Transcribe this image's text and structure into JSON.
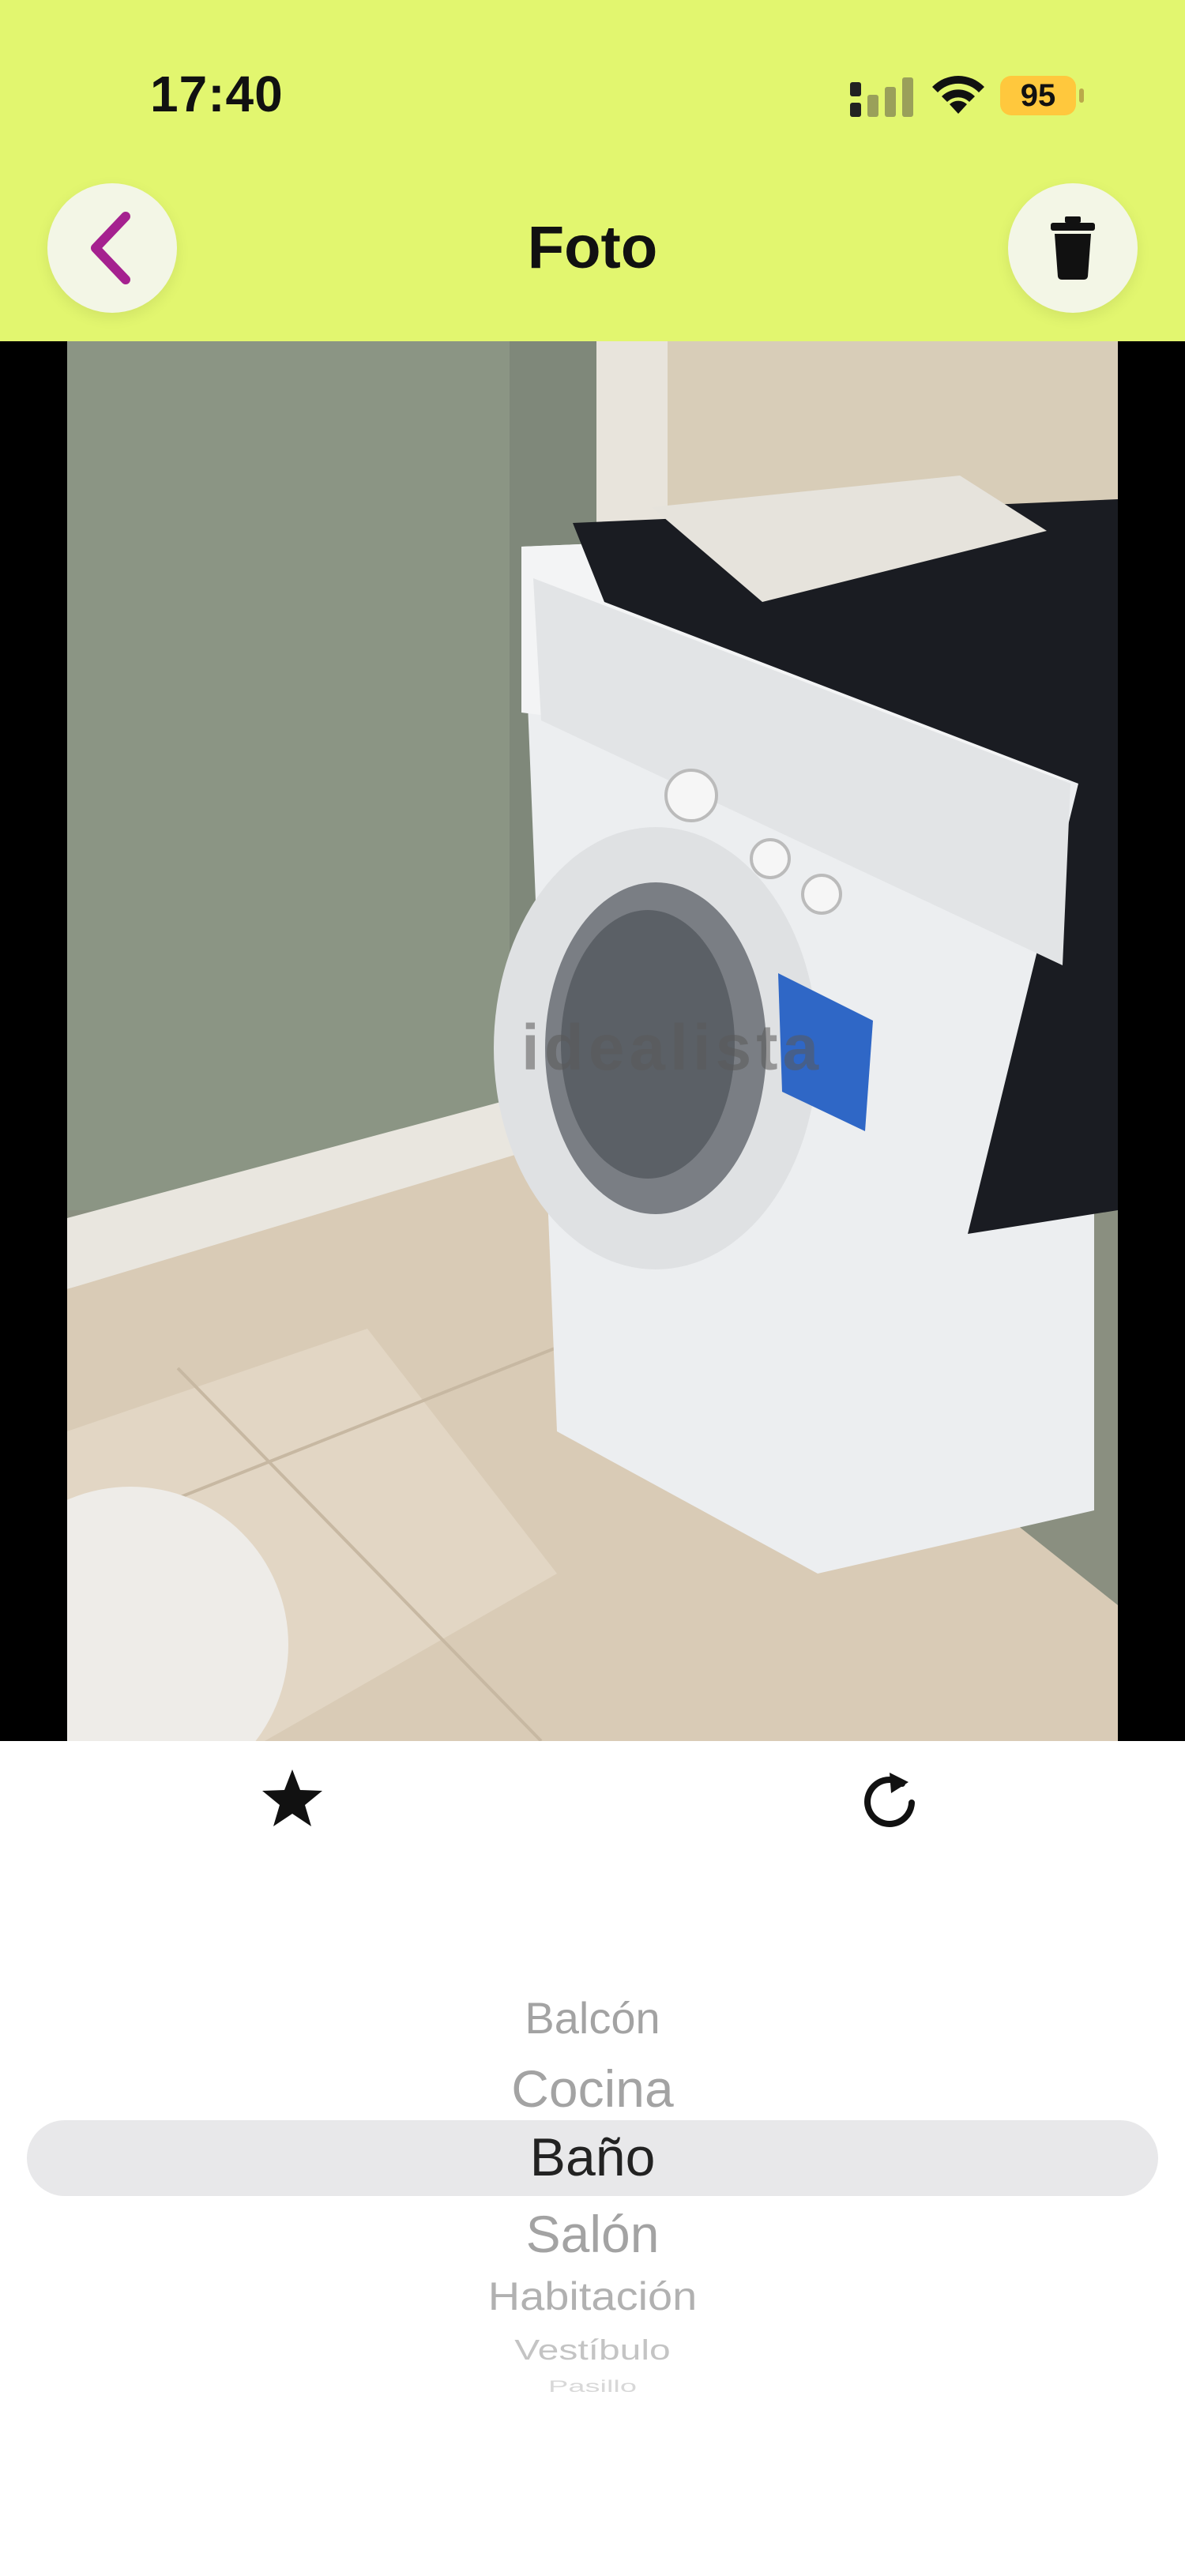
{
  "status_bar": {
    "time": "17:40",
    "battery": "95"
  },
  "header": {
    "title": "Foto",
    "back_icon": "chevron-left-icon",
    "delete_icon": "trash-icon",
    "background_color": "#e2f66f",
    "back_icon_color": "#a5218f"
  },
  "photo": {
    "watermark": "idealista"
  },
  "actions": {
    "favorite_icon": "star-icon",
    "rotate_icon": "rotate-icon"
  },
  "room_picker": {
    "options": [
      "Balcón",
      "Cocina",
      "Baño",
      "Salón",
      "Habitación",
      "Vestíbulo",
      "Pasillo"
    ],
    "selected": "Baño"
  }
}
